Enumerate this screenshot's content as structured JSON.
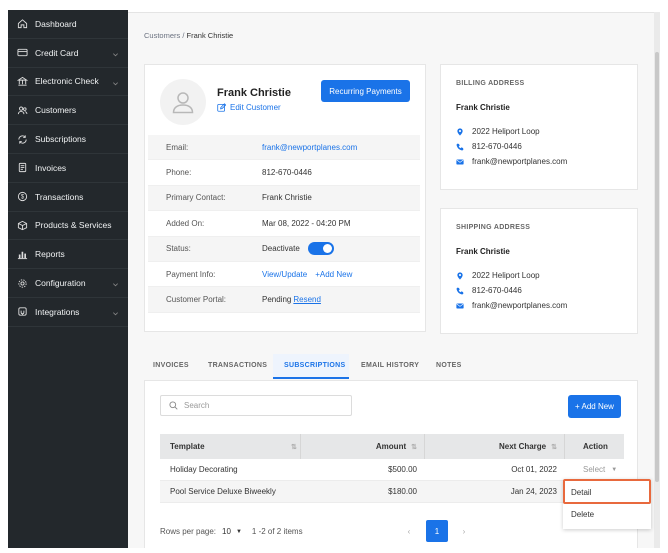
{
  "sidebar": {
    "items": [
      {
        "label": "Dashboard",
        "icon": "home-icon"
      },
      {
        "label": "Credit Card",
        "icon": "credit-card-icon",
        "expandable": true
      },
      {
        "label": "Electronic Check",
        "icon": "bank-icon",
        "expandable": true
      },
      {
        "label": "Customers",
        "icon": "users-icon"
      },
      {
        "label": "Subscriptions",
        "icon": "refresh-icon"
      },
      {
        "label": "Invoices",
        "icon": "invoice-icon"
      },
      {
        "label": "Transactions",
        "icon": "dollar-icon"
      },
      {
        "label": "Products & Services",
        "icon": "box-icon"
      },
      {
        "label": "Reports",
        "icon": "bar-chart-icon"
      },
      {
        "label": "Configuration",
        "icon": "gear-icon",
        "expandable": true
      },
      {
        "label": "Integrations",
        "icon": "plug-icon",
        "expandable": true
      }
    ]
  },
  "breadcrumb": {
    "parent": "Customers",
    "separator": "/",
    "current": "Frank Christie"
  },
  "customer": {
    "name": "Frank Christie",
    "edit_label": "Edit Customer",
    "recurring_label": "Recurring Payments",
    "rows": [
      {
        "label": "Email:",
        "value": "frank@newportplanes.com"
      },
      {
        "label": "Phone:",
        "value": "812-670-0446"
      },
      {
        "label": "Primary Contact:",
        "value": "Frank Christie"
      },
      {
        "label": "Added On:",
        "value": "Mar 08, 2022 - 04:20 PM"
      },
      {
        "label": "Status:",
        "value": "Deactivate"
      },
      {
        "label": "Payment Info:",
        "value": "View/Update",
        "extra": "+Add New"
      },
      {
        "label": "Customer Portal:",
        "value": "Pending",
        "extra": "Resend"
      }
    ]
  },
  "billing": {
    "heading": "BILLING ADDRESS",
    "name": "Frank Christie",
    "address": "2022 Heliport Loop",
    "phone": "812-670-0446",
    "email": "frank@newportplanes.com"
  },
  "shipping": {
    "heading": "SHIPPING ADDRESS",
    "name": "Frank Christie",
    "address": "2022 Heliport Loop",
    "phone": "812-670-0446",
    "email": "frank@newportplanes.com"
  },
  "tabs": [
    "INVOICES",
    "TRANSACTIONS",
    "SUBSCRIPTIONS",
    "EMAIL HISTORY",
    "NOTES"
  ],
  "active_tab": "SUBSCRIPTIONS",
  "search": {
    "placeholder": "Search"
  },
  "add_new_label": "+ Add New",
  "table": {
    "headers": {
      "template": "Template",
      "amount": "Amount",
      "next_charge": "Next Charge",
      "action": "Action"
    },
    "rows": [
      {
        "template": "Holiday Decorating",
        "amount": "$500.00",
        "next_charge": "Oct 01, 2022",
        "action": "Select"
      },
      {
        "template": "Pool Service Deluxe Biweekly",
        "amount": "$180.00",
        "next_charge": "Jan 24, 2023",
        "action": ""
      }
    ]
  },
  "action_menu": {
    "items": [
      "Detail",
      "Delete"
    ]
  },
  "pagination": {
    "rows_label": "Rows per page:",
    "rows_value": "10",
    "range": "1 -2 of 2 items",
    "current_page": "1"
  },
  "colors": {
    "accent": "#1a73e8",
    "sidebar_bg": "#23282c",
    "highlight": "#e8693d"
  }
}
